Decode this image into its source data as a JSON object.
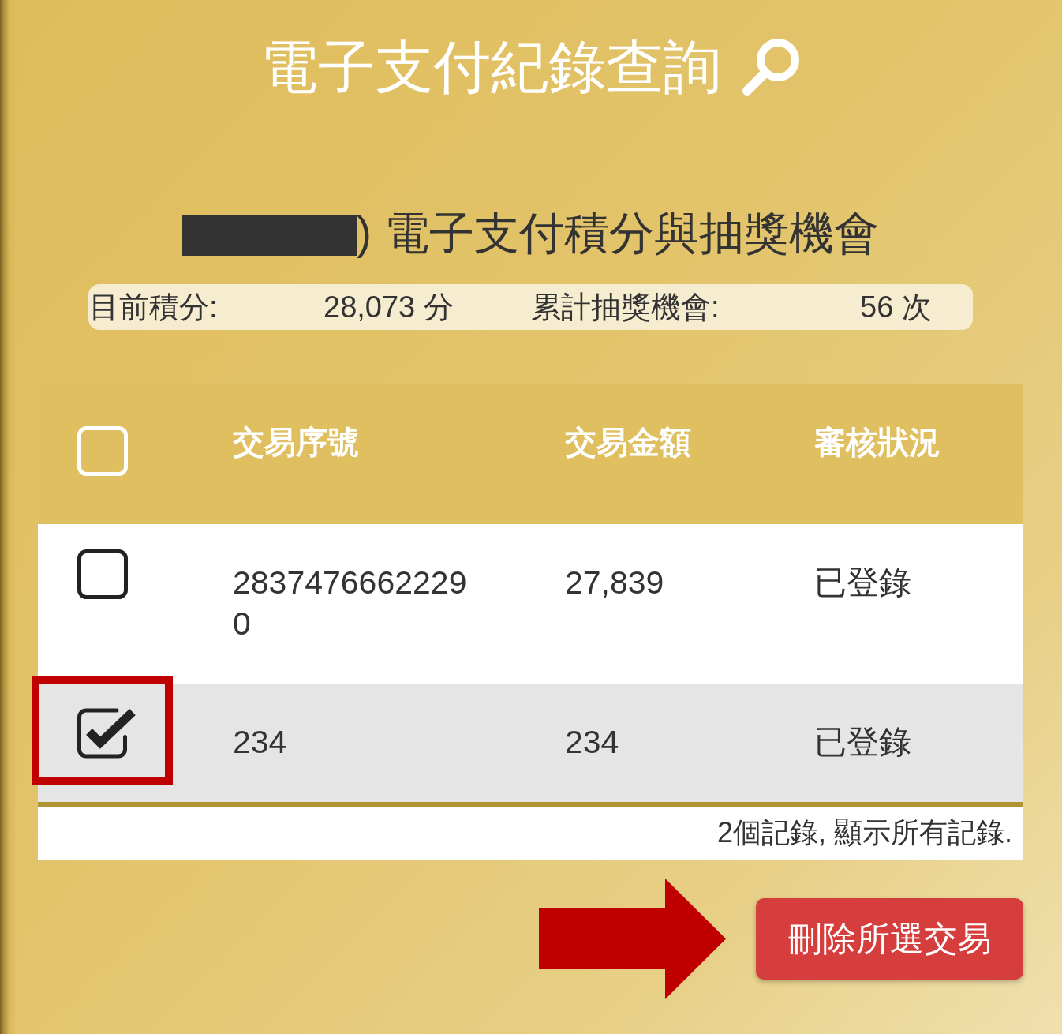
{
  "title": {
    "text": "電子支付紀錄查詢"
  },
  "summary": {
    "redacted": true,
    "heading": ") 電子支付積分與抽獎機會",
    "points_label": "目前積分:",
    "points_value": "28,073 分",
    "draws_label": "累計抽獎機會:",
    "draws_value": "56 次"
  },
  "table": {
    "select_all": {
      "checked": false
    },
    "columns": [
      "交易序號",
      "交易金額",
      "審核狀況"
    ],
    "rows": [
      {
        "checked": false,
        "framed": false,
        "serial": "28374766622290",
        "amount": "27,839",
        "status": "已登錄"
      },
      {
        "checked": true,
        "framed": true,
        "serial": "234",
        "amount": "234",
        "status": "已登錄"
      }
    ],
    "footer": "2個記錄, 顯示所有記錄."
  },
  "delete_button": {
    "label": "刪除所選交易",
    "arrow": true
  }
}
